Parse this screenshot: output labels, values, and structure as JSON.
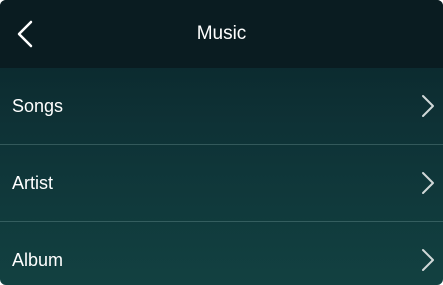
{
  "header": {
    "title": "Music",
    "back_icon": "chevron-left-icon"
  },
  "menu": {
    "items": [
      {
        "label": "Songs",
        "icon": "chevron-right-icon"
      },
      {
        "label": "Artist",
        "icon": "chevron-right-icon"
      },
      {
        "label": "Album",
        "icon": "chevron-right-icon"
      }
    ]
  },
  "colors": {
    "header_bg": "#0a1c21",
    "body_bg_top": "#0a2328",
    "body_bg_bottom": "#124141",
    "text": "#ffffff"
  }
}
